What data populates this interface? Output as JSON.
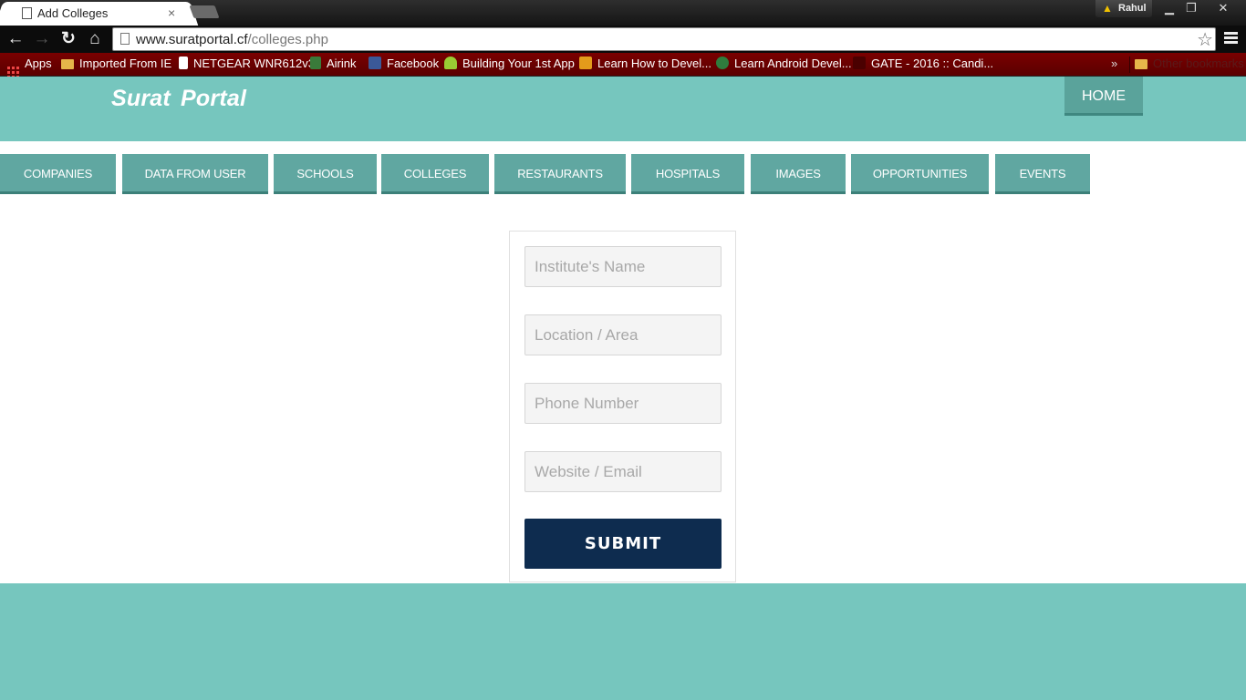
{
  "browser": {
    "tab_title": "Add Colleges",
    "tab_close": "×",
    "profile_name": "Rahul",
    "url_host": "www.suratportal.cf",
    "url_path": "/colleges.php",
    "controls": {
      "minimize": "▁",
      "restore": "❐",
      "close": "✕"
    },
    "bookmarks": [
      {
        "label": "Apps",
        "icon": "apps-grid-icon"
      },
      {
        "label": "Imported From IE",
        "icon": "folder-icon"
      },
      {
        "label": "NETGEAR WNR612v3",
        "icon": "page-icon"
      },
      {
        "label": "Airink",
        "icon": "airink-icon"
      },
      {
        "label": "Facebook",
        "icon": "facebook-icon"
      },
      {
        "label": "Building Your 1st App",
        "icon": "android-icon"
      },
      {
        "label": "Learn How to Devel...",
        "icon": "udemy-icon"
      },
      {
        "label": "Learn Android Devel...",
        "icon": "android-dev-icon"
      },
      {
        "label": "GATE - 2016 :: Candi...",
        "icon": "gate-icon"
      }
    ],
    "bookmarks_more": "»",
    "other_bookmarks": "Other bookmarks"
  },
  "site": {
    "brand": "Surat  Portal",
    "home_label": "HOME",
    "menu": [
      "COMPANIES",
      "DATA FROM USER",
      "SCHOOLS",
      "COLLEGES",
      "RESTAURANTS",
      "HOSPITALS",
      "IMAGES",
      "OPPORTUNITIES",
      "EVENTS"
    ]
  },
  "form": {
    "institute_placeholder": "Institute's Name",
    "location_placeholder": "Location / Area",
    "phone_placeholder": "Phone Number",
    "website_placeholder": "Website / Email",
    "submit_label": "SUBMIT"
  },
  "colors": {
    "header_bg": "#76c6be",
    "menu_bg": "#60a7a1",
    "submit_bg": "#0e2c4f",
    "bookmark_bar": "#7a0000"
  }
}
